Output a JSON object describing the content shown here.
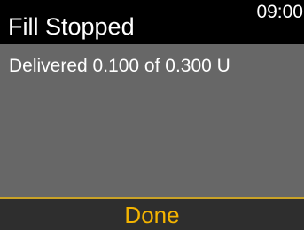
{
  "header": {
    "title": "Fill Stopped",
    "time": "09:00"
  },
  "body": {
    "message": "Delivered 0.100 of 0.300 U"
  },
  "footer": {
    "done_label": "Done"
  },
  "colors": {
    "header_background": "#000000",
    "body_background": "#676767",
    "footer_background": "#2e2e2e",
    "accent": "#f4b400",
    "text": "#ffffff"
  }
}
